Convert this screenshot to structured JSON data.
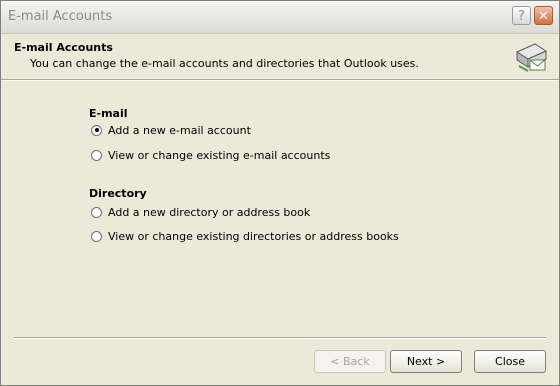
{
  "window": {
    "title": "E-mail Accounts",
    "help_glyph": "?",
    "close_glyph": "✕"
  },
  "header": {
    "title": "E-mail Accounts",
    "subtitle": "You can change the e-mail accounts and directories that Outlook uses.",
    "icon": "email-accounts-icon"
  },
  "email_group": {
    "label": "E-mail",
    "options": [
      {
        "label": "Add a new e-mail account",
        "selected": true
      },
      {
        "label": "View or change existing e-mail accounts",
        "selected": false
      }
    ]
  },
  "directory_group": {
    "label": "Directory",
    "options": [
      {
        "label": "Add a new directory or address book",
        "selected": false
      },
      {
        "label": "View or change existing directories or address books",
        "selected": false
      }
    ]
  },
  "buttons": {
    "back": "< Back",
    "next": "Next >",
    "close": "Close"
  }
}
